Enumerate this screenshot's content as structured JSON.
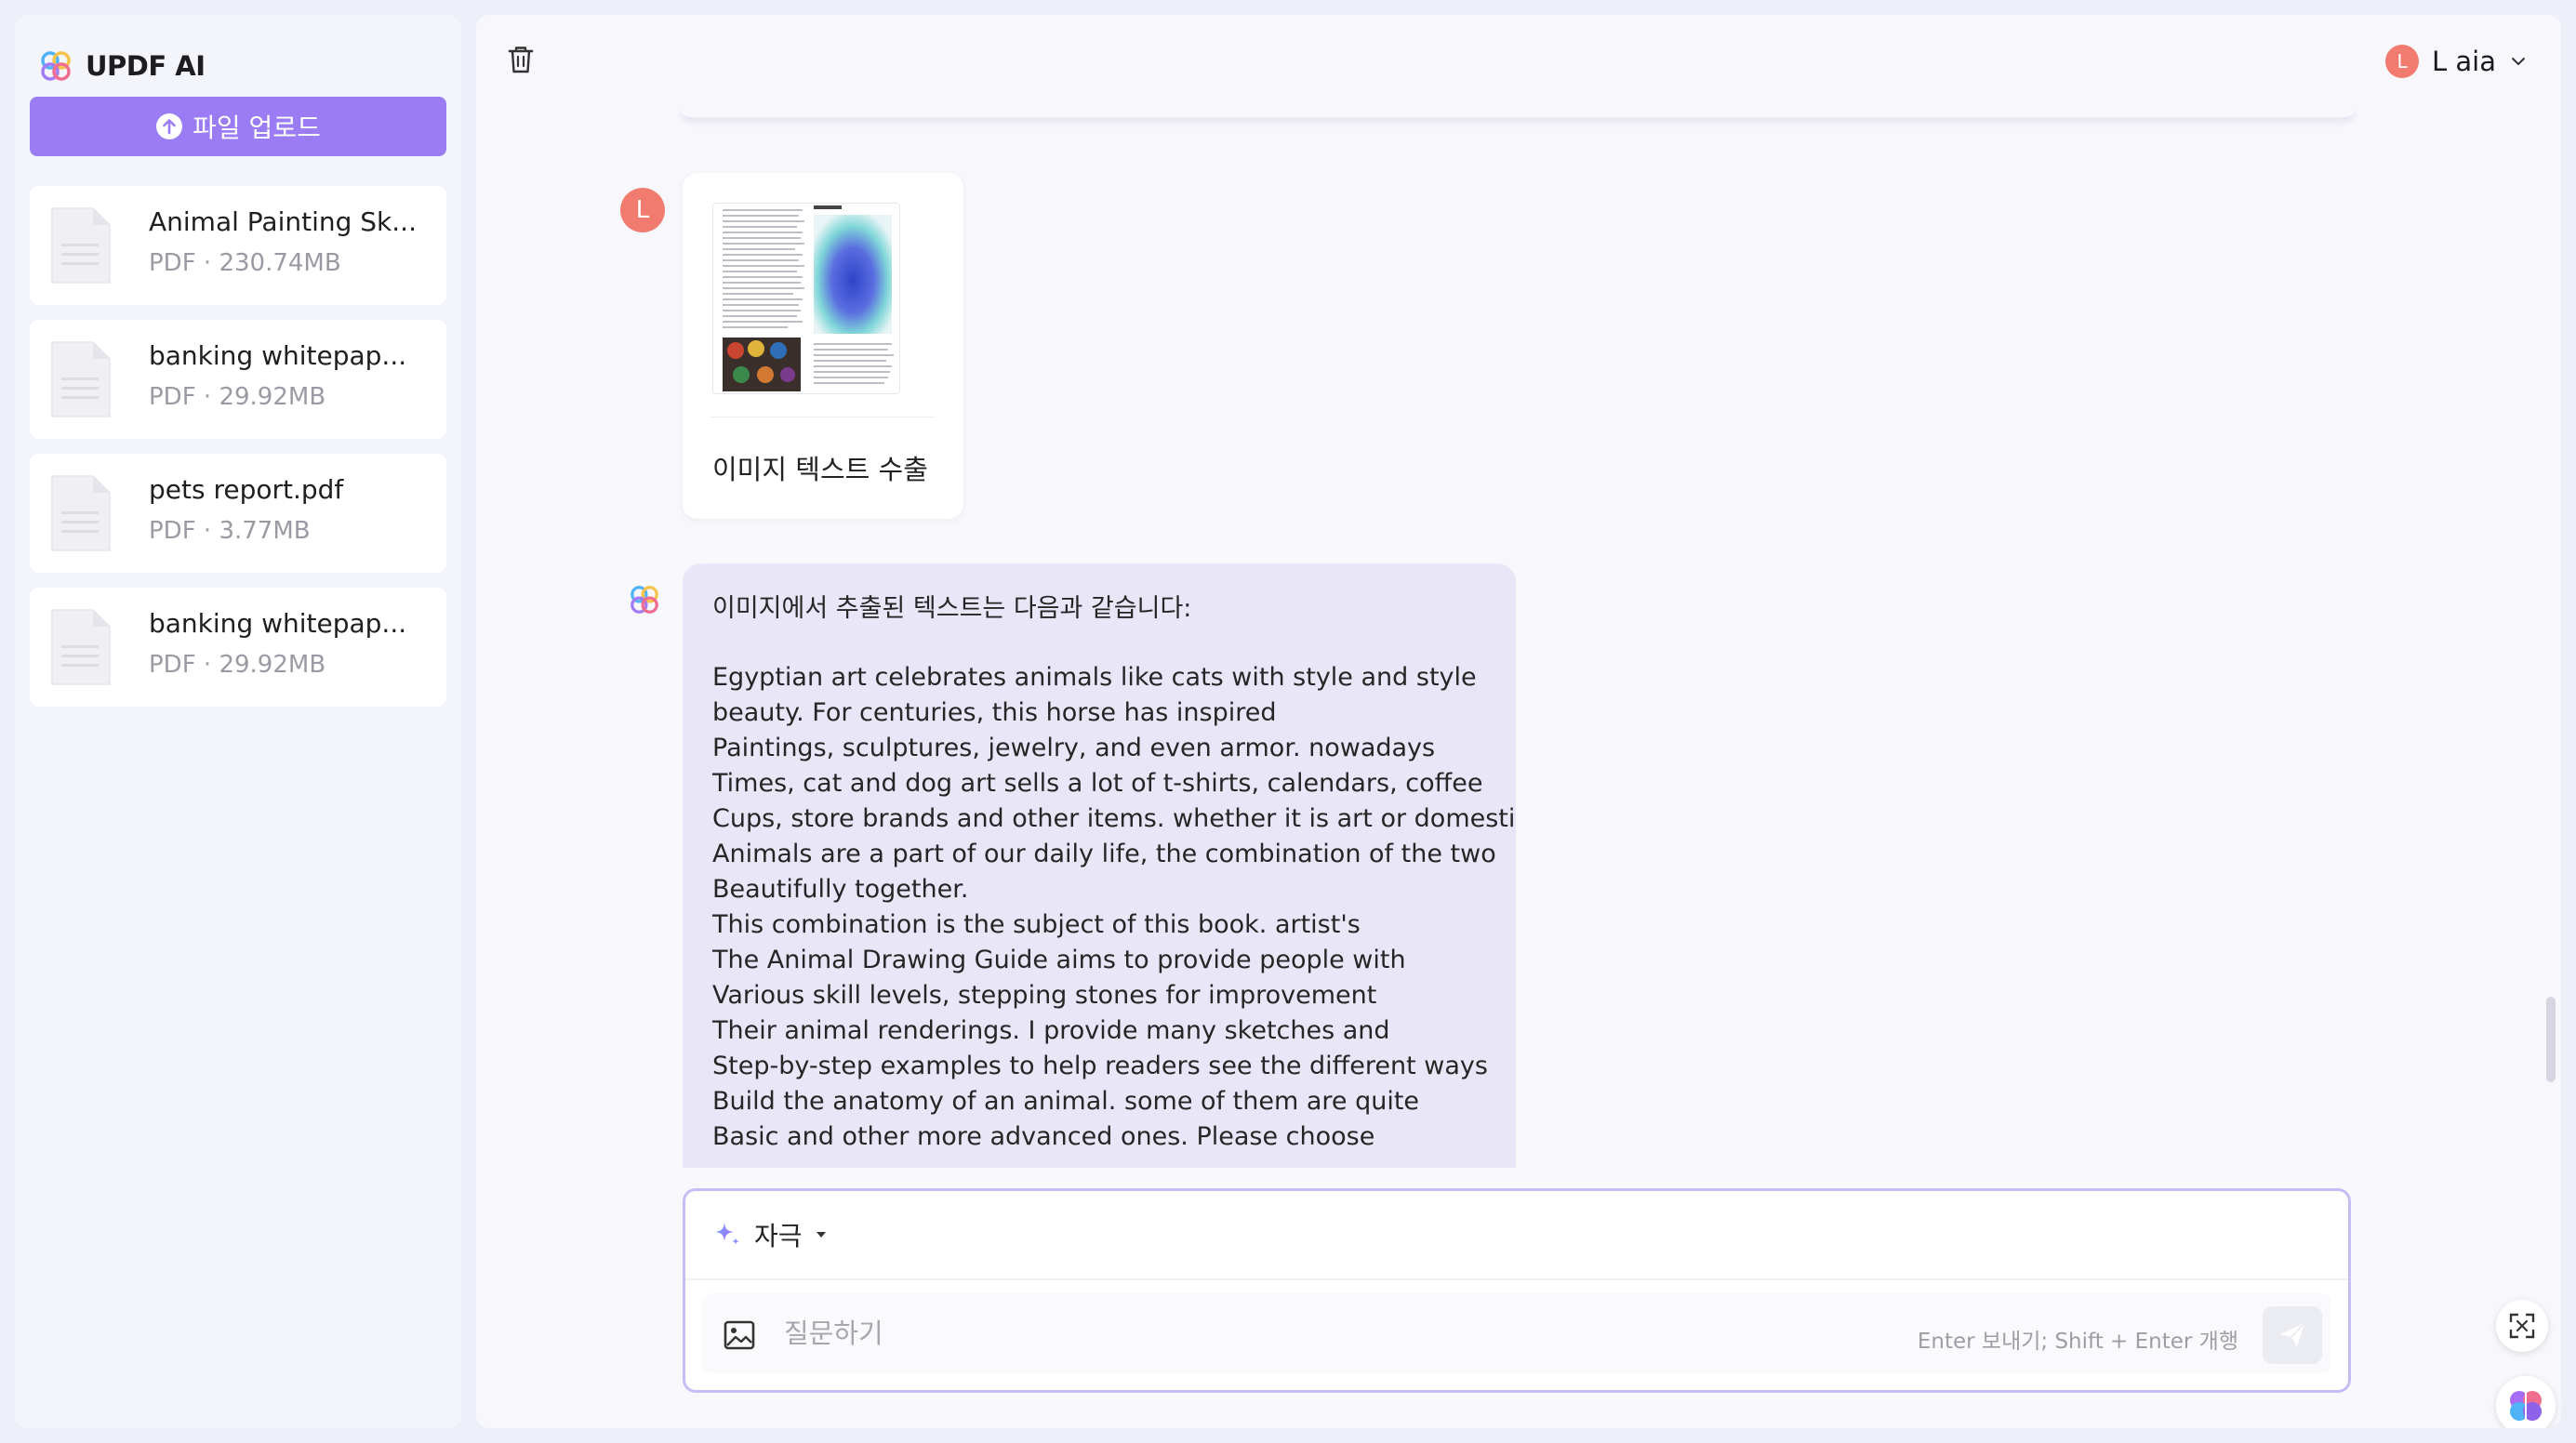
{
  "app": {
    "title": "UPDF AI"
  },
  "sidebar": {
    "upload_label": "파일 업로드",
    "files": [
      {
        "name": "Animal Painting Sk...",
        "meta": "PDF · 230.74MB"
      },
      {
        "name": "banking whitepap...",
        "meta": "PDF · 29.92MB"
      },
      {
        "name": "pets report.pdf",
        "meta": "PDF · 3.77MB"
      },
      {
        "name": "banking whitepap...",
        "meta": "PDF · 29.92MB"
      }
    ]
  },
  "header": {
    "user_initial": "L",
    "user_name": "L aia"
  },
  "chat": {
    "user_avatar_initial": "L",
    "image_card_label": "이미지 텍스트 수출",
    "ai_intro": "이미지에서 추출된 텍스트는 다음과 같습니다:",
    "ai_lines": [
      "Egyptian art celebrates animals like cats with style and style",
      "beauty. For centuries, this horse has inspired",
      "Paintings, sculptures, jewelry, and even armor. nowadays",
      "Times, cat and dog art sells a lot of t-shirts, calendars, coffee",
      "Cups, store brands and other items. whether it is art or domestic",
      "Animals are a part of our daily life, the combination of the two",
      "Beautifully together.",
      "This combination is the subject of this book. artist's",
      "The Animal Drawing Guide aims to provide people with",
      "Various skill levels, stepping stones for improvement",
      "Their animal renderings. I provide many sketches and",
      "Step-by-step examples to help readers see the different ways",
      "Build the anatomy of an animal. some of them are quite",
      "Basic and other more advanced ones. Please choose"
    ]
  },
  "input": {
    "mode_label": "자극",
    "placeholder": "질문하기",
    "hint": "Enter 보내기; Shift + Enter 개행"
  },
  "colors": {
    "accent": "#9b7cf5",
    "avatar": "#f07b6e",
    "ai_bubble": "#e9e6f7"
  },
  "icons": {
    "logo": "updf-logo-icon",
    "upload": "upload-arrow-icon",
    "file": "document-icon",
    "trash": "trash-icon",
    "chevron": "chevron-down-icon",
    "spark": "sparkle-icon",
    "image": "image-icon",
    "send": "send-icon"
  }
}
